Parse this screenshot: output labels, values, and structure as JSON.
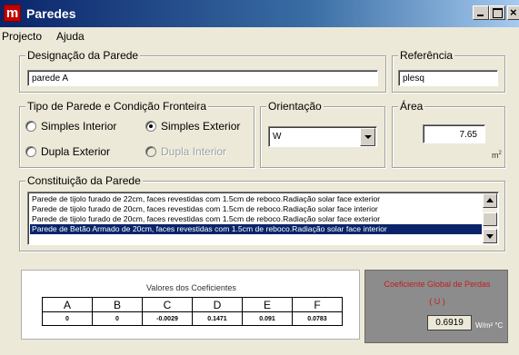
{
  "window": {
    "title": "Paredes",
    "app_icon": "m"
  },
  "menu": [
    "Projecto",
    "Ajuda"
  ],
  "designacao": {
    "label": "Designação da Parede",
    "value": "parede A"
  },
  "referencia": {
    "label": "Referência",
    "value": "plesq"
  },
  "tipo": {
    "label": "Tipo de Parede e Condição Fronteira",
    "options": [
      {
        "label": "Simples Interior",
        "selected": false,
        "disabled": false
      },
      {
        "label": "Simples Exterior",
        "selected": true,
        "disabled": false
      },
      {
        "label": "Dupla Exterior",
        "selected": false,
        "disabled": false
      },
      {
        "label": "Dupla Interior",
        "selected": false,
        "disabled": true
      }
    ]
  },
  "orientacao": {
    "label": "Orientação",
    "value": "W"
  },
  "area": {
    "label": "Área",
    "value": "7.65",
    "unit": "m",
    "unit_sup": "2"
  },
  "constituicao": {
    "label": "Constituição da Parede",
    "items": [
      "Parede de tijolo furado de 22cm, faces revestidas com 1.5cm de reboco.Radiação solar face exterior",
      "Parede de tijolo furado de 20cm, faces revestidas com 1.5cm de reboco.Radiação solar face interior",
      "Parede de tijolo furado de 20cm, faces revestidas com 1.5cm de reboco.Radiação solar face exterior",
      "Parede de Betão Armado de 20cm, faces revestidas com 1.5cm de reboco.Radiação solar face interior"
    ],
    "selected_index": 3
  },
  "coeficientes": {
    "title": "Valores dos Coeficientes",
    "headers": [
      "A",
      "B",
      "C",
      "D",
      "E",
      "F"
    ],
    "values": [
      "0",
      "0",
      "-0.0029",
      "0.1471",
      "0.091",
      "0.0783"
    ]
  },
  "global": {
    "title": "Coeficiente Global de Perdas",
    "symbol": "( U )",
    "value": "0.6919",
    "unit": "W/m² °C"
  },
  "colors": {
    "titlebar_start": "#0a246a",
    "selection": "#0a246a",
    "global_text": "#c02020"
  }
}
